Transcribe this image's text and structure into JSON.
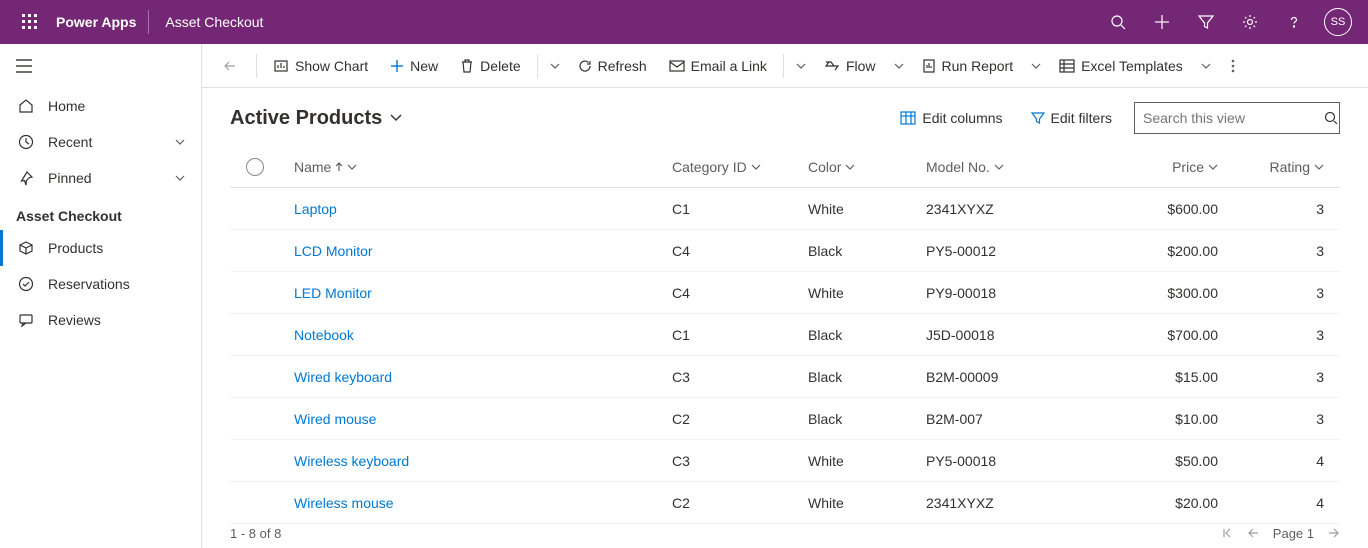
{
  "header": {
    "brand": "Power Apps",
    "app_name": "Asset Checkout",
    "avatar_initials": "SS"
  },
  "sidebar": {
    "home": "Home",
    "recent": "Recent",
    "pinned": "Pinned",
    "group_label": "Asset Checkout",
    "products": "Products",
    "reservations": "Reservations",
    "reviews": "Reviews"
  },
  "commands": {
    "show_chart": "Show Chart",
    "new": "New",
    "delete": "Delete",
    "refresh": "Refresh",
    "email_link": "Email a Link",
    "flow": "Flow",
    "run_report": "Run Report",
    "excel_templates": "Excel Templates"
  },
  "view": {
    "title": "Active Products",
    "edit_columns": "Edit columns",
    "edit_filters": "Edit filters",
    "search_placeholder": "Search this view"
  },
  "columns": {
    "name": "Name",
    "category_id": "Category ID",
    "color": "Color",
    "model_no": "Model No.",
    "price": "Price",
    "rating": "Rating"
  },
  "rows": [
    {
      "name": "Laptop",
      "category_id": "C1",
      "color": "White",
      "model_no": "2341XYXZ",
      "price": "$600.00",
      "rating": "3"
    },
    {
      "name": "LCD Monitor",
      "category_id": "C4",
      "color": "Black",
      "model_no": "PY5-00012",
      "price": "$200.00",
      "rating": "3"
    },
    {
      "name": "LED Monitor",
      "category_id": "C4",
      "color": "White",
      "model_no": "PY9-00018",
      "price": "$300.00",
      "rating": "3"
    },
    {
      "name": "Notebook",
      "category_id": "C1",
      "color": "Black",
      "model_no": "J5D-00018",
      "price": "$700.00",
      "rating": "3"
    },
    {
      "name": "Wired keyboard",
      "category_id": "C3",
      "color": "Black",
      "model_no": "B2M-00009",
      "price": "$15.00",
      "rating": "3"
    },
    {
      "name": "Wired mouse",
      "category_id": "C2",
      "color": "Black",
      "model_no": "B2M-007",
      "price": "$10.00",
      "rating": "3"
    },
    {
      "name": "Wireless keyboard",
      "category_id": "C3",
      "color": "White",
      "model_no": "PY5-00018",
      "price": "$50.00",
      "rating": "4"
    },
    {
      "name": "Wireless mouse",
      "category_id": "C2",
      "color": "White",
      "model_no": "2341XYXZ",
      "price": "$20.00",
      "rating": "4"
    }
  ],
  "footer": {
    "status": "1 - 8 of 8",
    "page": "Page 1"
  }
}
